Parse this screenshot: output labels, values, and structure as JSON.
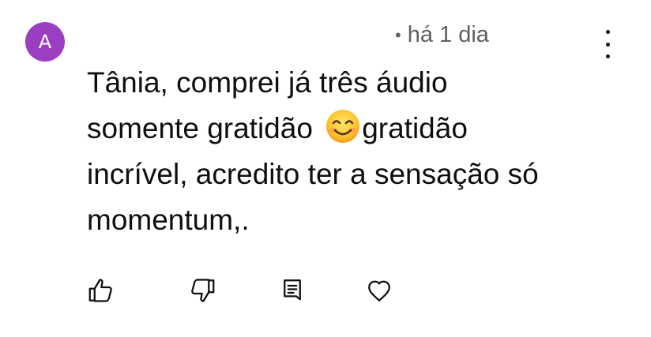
{
  "author": {
    "avatar_letter": "A",
    "avatar_color": "#9c3ec2"
  },
  "meta": {
    "separator": "•",
    "timestamp": "há 1 dia"
  },
  "comment": {
    "line1": "Tânia, comprei já três áudio",
    "line2_before_emoji": "somente gratidão ",
    "emoji": "smiling-face-emoji",
    "line2_after_emoji": "gratidão",
    "line3": "incrível, acredito ter a sensação só",
    "line4": "momentum,."
  },
  "actions": {
    "icons": [
      "thumbs-up-icon",
      "thumbs-down-icon",
      "reply-icon",
      "heart-icon"
    ]
  },
  "menu": {
    "icon": "more-vert-icon"
  }
}
